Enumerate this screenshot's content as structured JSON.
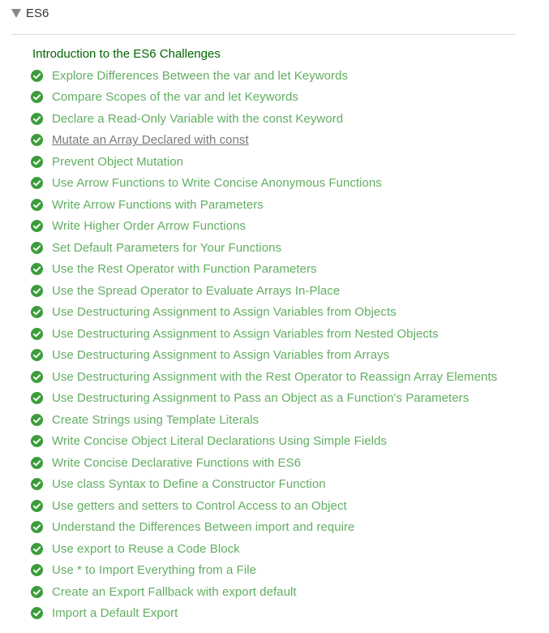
{
  "section": {
    "title": "ES6",
    "intro": "Introduction to the ES6 Challenges"
  },
  "colors": {
    "check": "#3c9c3c",
    "item_text": "#62ae62",
    "intro_text": "#006400",
    "visited_text": "#7a7a7a"
  },
  "challenges": [
    {
      "label": "Explore Differences Between the var and let Keywords",
      "completed": true
    },
    {
      "label": "Compare Scopes of the var and let Keywords",
      "completed": true
    },
    {
      "label": "Declare a Read-Only Variable with the const Keyword",
      "completed": true
    },
    {
      "label": "Mutate an Array Declared with const",
      "completed": true,
      "visited": true
    },
    {
      "label": "Prevent Object Mutation",
      "completed": true
    },
    {
      "label": "Use Arrow Functions to Write Concise Anonymous Functions",
      "completed": true
    },
    {
      "label": "Write Arrow Functions with Parameters",
      "completed": true
    },
    {
      "label": "Write Higher Order Arrow Functions",
      "completed": true
    },
    {
      "label": "Set Default Parameters for Your Functions",
      "completed": true
    },
    {
      "label": "Use the Rest Operator with Function Parameters",
      "completed": true
    },
    {
      "label": "Use the Spread Operator to Evaluate Arrays In-Place",
      "completed": true
    },
    {
      "label": "Use Destructuring Assignment to Assign Variables from Objects",
      "completed": true
    },
    {
      "label": "Use Destructuring Assignment to Assign Variables from Nested Objects",
      "completed": true
    },
    {
      "label": "Use Destructuring Assignment to Assign Variables from Arrays",
      "completed": true
    },
    {
      "label": "Use Destructuring Assignment with the Rest Operator to Reassign Array Elements",
      "completed": true
    },
    {
      "label": "Use Destructuring Assignment to Pass an Object as a Function's Parameters",
      "completed": true
    },
    {
      "label": "Create Strings using Template Literals",
      "completed": true
    },
    {
      "label": "Write Concise Object Literal Declarations Using Simple Fields",
      "completed": true
    },
    {
      "label": "Write Concise Declarative Functions with ES6",
      "completed": true
    },
    {
      "label": "Use class Syntax to Define a Constructor Function",
      "completed": true
    },
    {
      "label": "Use getters and setters to Control Access to an Object",
      "completed": true
    },
    {
      "label": "Understand the Differences Between import and require",
      "completed": true
    },
    {
      "label": "Use export to Reuse a Code Block",
      "completed": true
    },
    {
      "label": "Use * to Import Everything from a File",
      "completed": true
    },
    {
      "label": "Create an Export Fallback with export default",
      "completed": true
    },
    {
      "label": "Import a Default Export",
      "completed": true
    }
  ]
}
